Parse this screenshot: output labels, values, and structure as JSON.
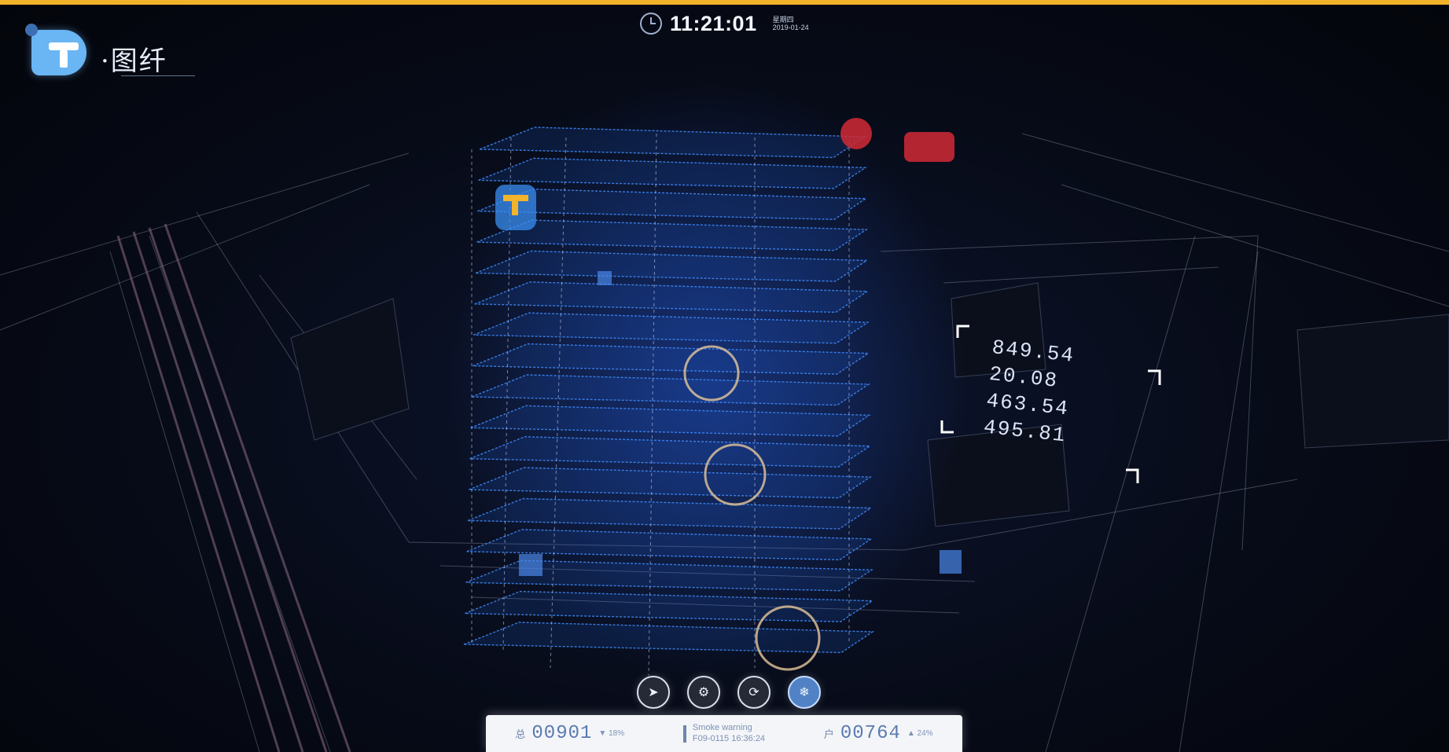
{
  "brand": {
    "logo_text": "·图纤"
  },
  "header": {
    "time": "11:21:01",
    "weekday": "星期四",
    "date": "2019-01-24"
  },
  "scene_stats": [
    {
      "label": "",
      "value": "849.54",
      "unit": ""
    },
    {
      "label": "",
      "value": "20.08",
      "unit": ""
    },
    {
      "label": "",
      "value": "463.54",
      "unit": ""
    },
    {
      "label": "",
      "value": "495.81",
      "unit": ""
    }
  ],
  "controls": [
    {
      "icon": "cursor-icon"
    },
    {
      "icon": "settings-icon"
    },
    {
      "icon": "refresh-icon"
    },
    {
      "icon": "snowflake-icon"
    }
  ],
  "status_bar": {
    "left": {
      "label": "总",
      "value": "00901",
      "delta": "▼ 18%"
    },
    "event": {
      "title": "Smoke warning",
      "subtitle": "F09-0115  16:36:24"
    },
    "right": {
      "label": "户",
      "value": "00764",
      "delta": "▲ 24%"
    }
  },
  "colors": {
    "accent": "#f2b229",
    "building": "#2f7cff",
    "background": "#070b18"
  }
}
